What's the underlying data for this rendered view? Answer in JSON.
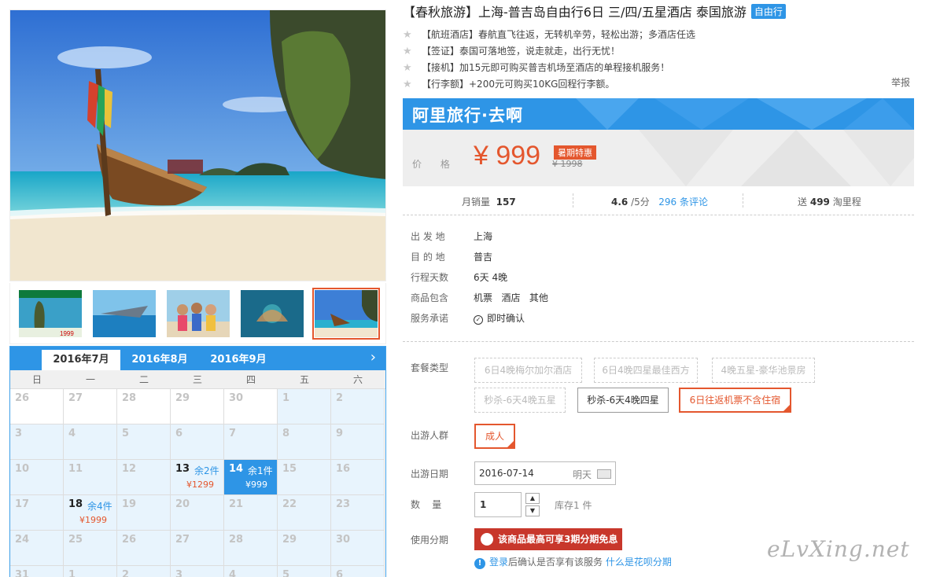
{
  "title": {
    "text": "【春秋旅游】上海-普吉岛自由行6日 三/四/五星酒店 泰国旅游",
    "tag": "自由行"
  },
  "features": [
    {
      "icon": "star-icon",
      "text": "【航班酒店】春航直飞往返，无转机辛劳，轻松出游；多酒店任选"
    },
    {
      "icon": "star-icon",
      "text": "【签证】泰国可落地签，说走就走，出行无忧！"
    },
    {
      "icon": "star-icon",
      "text": "【接机】加15元即可购买普吉机场至酒店的单程接机服务！"
    },
    {
      "icon": "star-icon",
      "text": "【行李额】+200元可购买10KG回程行李额。"
    }
  ],
  "report_label": "举报",
  "promo": {
    "brand": "阿里旅行·去啊",
    "price_label": "价 格",
    "price": "¥ 999",
    "badge": "暑期特惠",
    "original_price": "¥ 1998"
  },
  "stats": {
    "monthly_sales_label": "月销量",
    "monthly_sales": "157",
    "rating": "4.6",
    "rating_scale": "/5分",
    "reviews": "296 条评论",
    "points_prefix": "送",
    "points_value": "499",
    "points_suffix": "淘里程"
  },
  "info": [
    {
      "key": "出 发 地",
      "value": "上海"
    },
    {
      "key": "目 的 地",
      "value": "普吉"
    },
    {
      "key": "行程天数",
      "value": "6天 4晚"
    },
    {
      "key": "商品包含",
      "value": "机票   酒店   其他"
    },
    {
      "key": "服务承诺",
      "value": "即时确认",
      "icon": "check-circle-icon"
    }
  ],
  "options": {
    "package_label": "套餐类型",
    "packages": [
      {
        "label": "6日4晚梅尔加尔酒店",
        "state": "disabled"
      },
      {
        "label": "6日4晚四星最佳西方",
        "state": "disabled"
      },
      {
        "label": "4晚五星-豪华池景房",
        "state": "disabled"
      },
      {
        "label": "秒杀-6天4晚五星",
        "state": "disabled"
      },
      {
        "label": "秒杀-6天4晚四星",
        "state": "normal"
      },
      {
        "label": "6日往返机票不含住宿",
        "state": "selected"
      }
    ],
    "traveler_label": "出游人群",
    "traveler": "成人",
    "date_label": "出游日期",
    "date_value": "2016-07-14",
    "date_hint": "明天",
    "qty_label": "数    量",
    "qty_value": "1",
    "stock": "库存1 件",
    "installment_label": "使用分期",
    "installment_button": "该商品最高可享3期分期免息",
    "login_link": "登录",
    "login_text": "后确认是否享有该服务",
    "huabei_link": "什么是花呗分期"
  },
  "calendar": {
    "tabs": [
      "2016年7月",
      "2016年8月",
      "2016年9月"
    ],
    "weekdays": [
      "日",
      "一",
      "二",
      "三",
      "四",
      "五",
      "六"
    ],
    "rows": [
      [
        {
          "d": "26"
        },
        {
          "d": "27"
        },
        {
          "d": "28"
        },
        {
          "d": "29"
        },
        {
          "d": "30"
        },
        {
          "d": "1"
        },
        {
          "d": "2"
        }
      ],
      [
        {
          "d": "3"
        },
        {
          "d": "4"
        },
        {
          "d": "5"
        },
        {
          "d": "6"
        },
        {
          "d": "7"
        },
        {
          "d": "8"
        },
        {
          "d": "9"
        }
      ],
      [
        {
          "d": "10"
        },
        {
          "d": "11"
        },
        {
          "d": "12"
        },
        {
          "d": "13",
          "r": "余2件",
          "p": "¥1299"
        },
        {
          "d": "14",
          "r": "余1件",
          "p": "¥999",
          "sel": true
        },
        {
          "d": "15"
        },
        {
          "d": "16"
        }
      ],
      [
        {
          "d": "17"
        },
        {
          "d": "18",
          "r": "余4件",
          "p": "¥1999"
        },
        {
          "d": "19"
        },
        {
          "d": "20"
        },
        {
          "d": "21"
        },
        {
          "d": "22"
        },
        {
          "d": "23"
        }
      ],
      [
        {
          "d": "24"
        },
        {
          "d": "25"
        },
        {
          "d": "26"
        },
        {
          "d": "27"
        },
        {
          "d": "28"
        },
        {
          "d": "29"
        },
        {
          "d": "30"
        }
      ],
      [
        {
          "d": "31"
        },
        {
          "d": "1"
        },
        {
          "d": "2"
        },
        {
          "d": "3"
        },
        {
          "d": "4"
        },
        {
          "d": "5"
        },
        {
          "d": "6"
        }
      ]
    ]
  },
  "thumb_text": {
    "label": "1999"
  },
  "watermark": "eLvXing.net"
}
